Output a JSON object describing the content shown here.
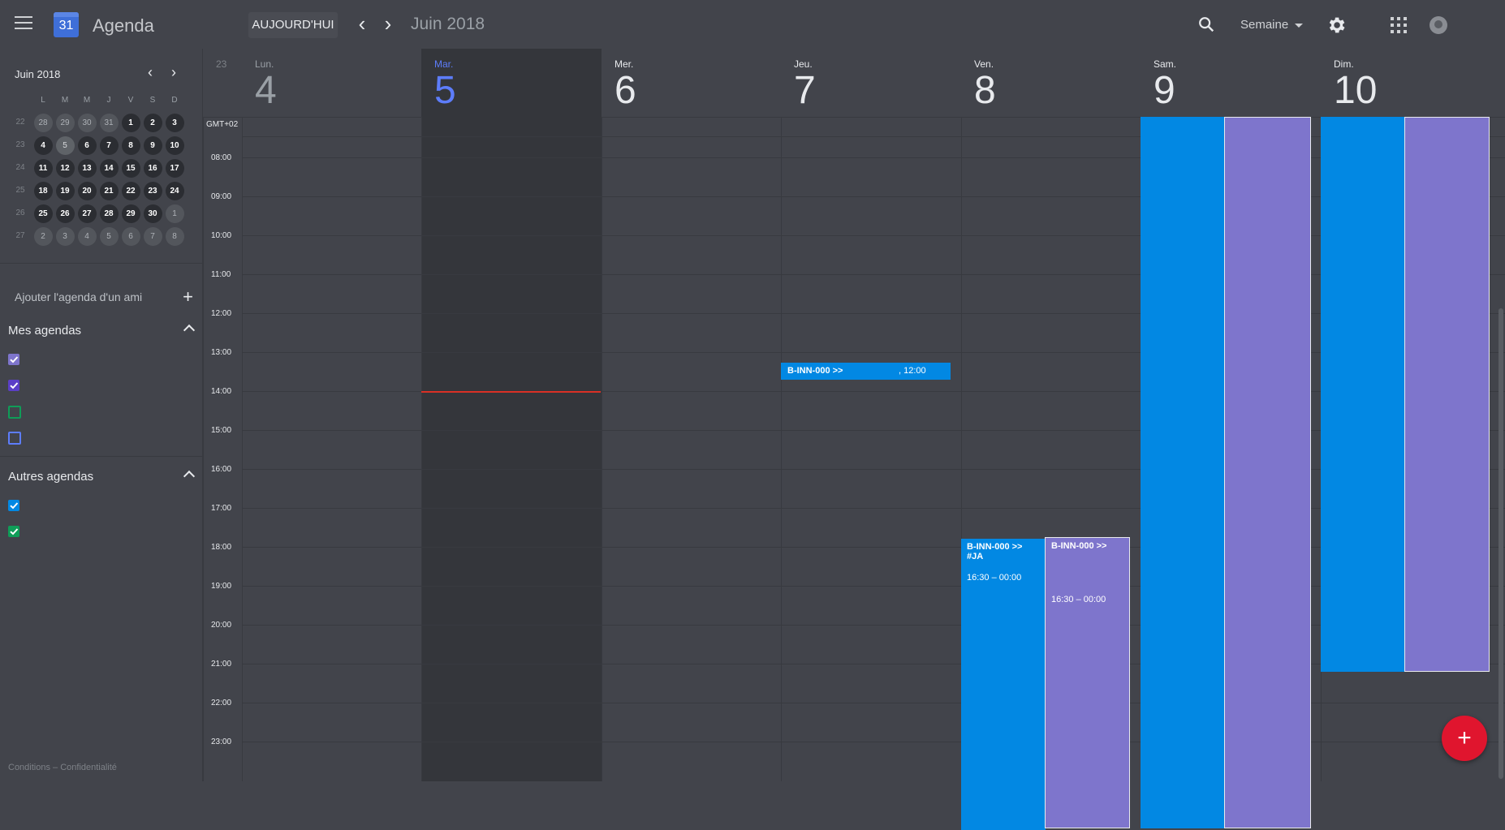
{
  "app": {
    "title": "Agenda",
    "logo_number": "31"
  },
  "toolbar": {
    "today_label": "AUJOURD'HUI",
    "prev_icon": "chevron-left-icon",
    "next_icon": "chevron-right-icon",
    "period": "Juin 2018",
    "view_label": "Semaine"
  },
  "mini_calendar": {
    "title": "Juin 2018",
    "weekdays": [
      "L",
      "M",
      "M",
      "J",
      "V",
      "S",
      "D"
    ],
    "weeks": [
      {
        "num": "22",
        "days": [
          "28",
          "29",
          "30",
          "31",
          "1",
          "2",
          "3"
        ]
      },
      {
        "num": "23",
        "days": [
          "4",
          "5",
          "6",
          "7",
          "8",
          "9",
          "10"
        ]
      },
      {
        "num": "24",
        "days": [
          "11",
          "12",
          "13",
          "14",
          "15",
          "16",
          "17"
        ]
      },
      {
        "num": "25",
        "days": [
          "18",
          "19",
          "20",
          "21",
          "22",
          "23",
          "24"
        ]
      },
      {
        "num": "26",
        "days": [
          "25",
          "26",
          "27",
          "28",
          "29",
          "30",
          "1"
        ]
      },
      {
        "num": "27",
        "days": [
          "2",
          "3",
          "4",
          "5",
          "6",
          "7",
          "8"
        ]
      }
    ]
  },
  "sidebar": {
    "add_friend_label": "Ajouter l'agenda d'un ami",
    "my_calendars_label": "Mes agendas",
    "my_calendars": [
      {
        "color": "#7e75cc",
        "checked": true
      },
      {
        "color": "#5b3fc7",
        "checked": true
      },
      {
        "color": "#0f9d58",
        "checked": false
      },
      {
        "color": "#5d7dfb",
        "checked": false
      }
    ],
    "other_calendars_label": "Autres agendas",
    "other_calendars": [
      {
        "color": "#0288e3",
        "checked": true
      },
      {
        "color": "#0f9d58",
        "checked": true
      }
    ],
    "footer": "Conditions – Confidentialité"
  },
  "week": {
    "week_number": "23",
    "timezone": "GMT+02",
    "days": [
      {
        "name": "Lun.",
        "num": "4"
      },
      {
        "name": "Mar.",
        "num": "5"
      },
      {
        "name": "Mer.",
        "num": "6"
      },
      {
        "name": "Jeu.",
        "num": "7"
      },
      {
        "name": "Ven.",
        "num": "8"
      },
      {
        "name": "Sam.",
        "num": "9"
      },
      {
        "name": "Dim.",
        "num": "10"
      }
    ],
    "hours": [
      "08:00",
      "09:00",
      "10:00",
      "11:00",
      "12:00",
      "13:00",
      "14:00",
      "15:00",
      "16:00",
      "17:00",
      "18:00",
      "19:00",
      "20:00",
      "21:00",
      "22:00",
      "23:00"
    ]
  },
  "events": [
    {
      "title": "B-INN-000 >>",
      "time": ", 12:00"
    },
    {
      "title": "B-INN-000 >> #JA",
      "time": "16:30 – 00:00"
    },
    {
      "title": "B-INN-000 >>",
      "time": "16:30 – 00:00"
    }
  ],
  "colors": {
    "accent": "#5d7dfb",
    "event_blue": "#0288e3",
    "event_purple": "#7e75cc",
    "fab": "#e0152e",
    "now_line": "#d93025"
  },
  "fab_label": "+"
}
